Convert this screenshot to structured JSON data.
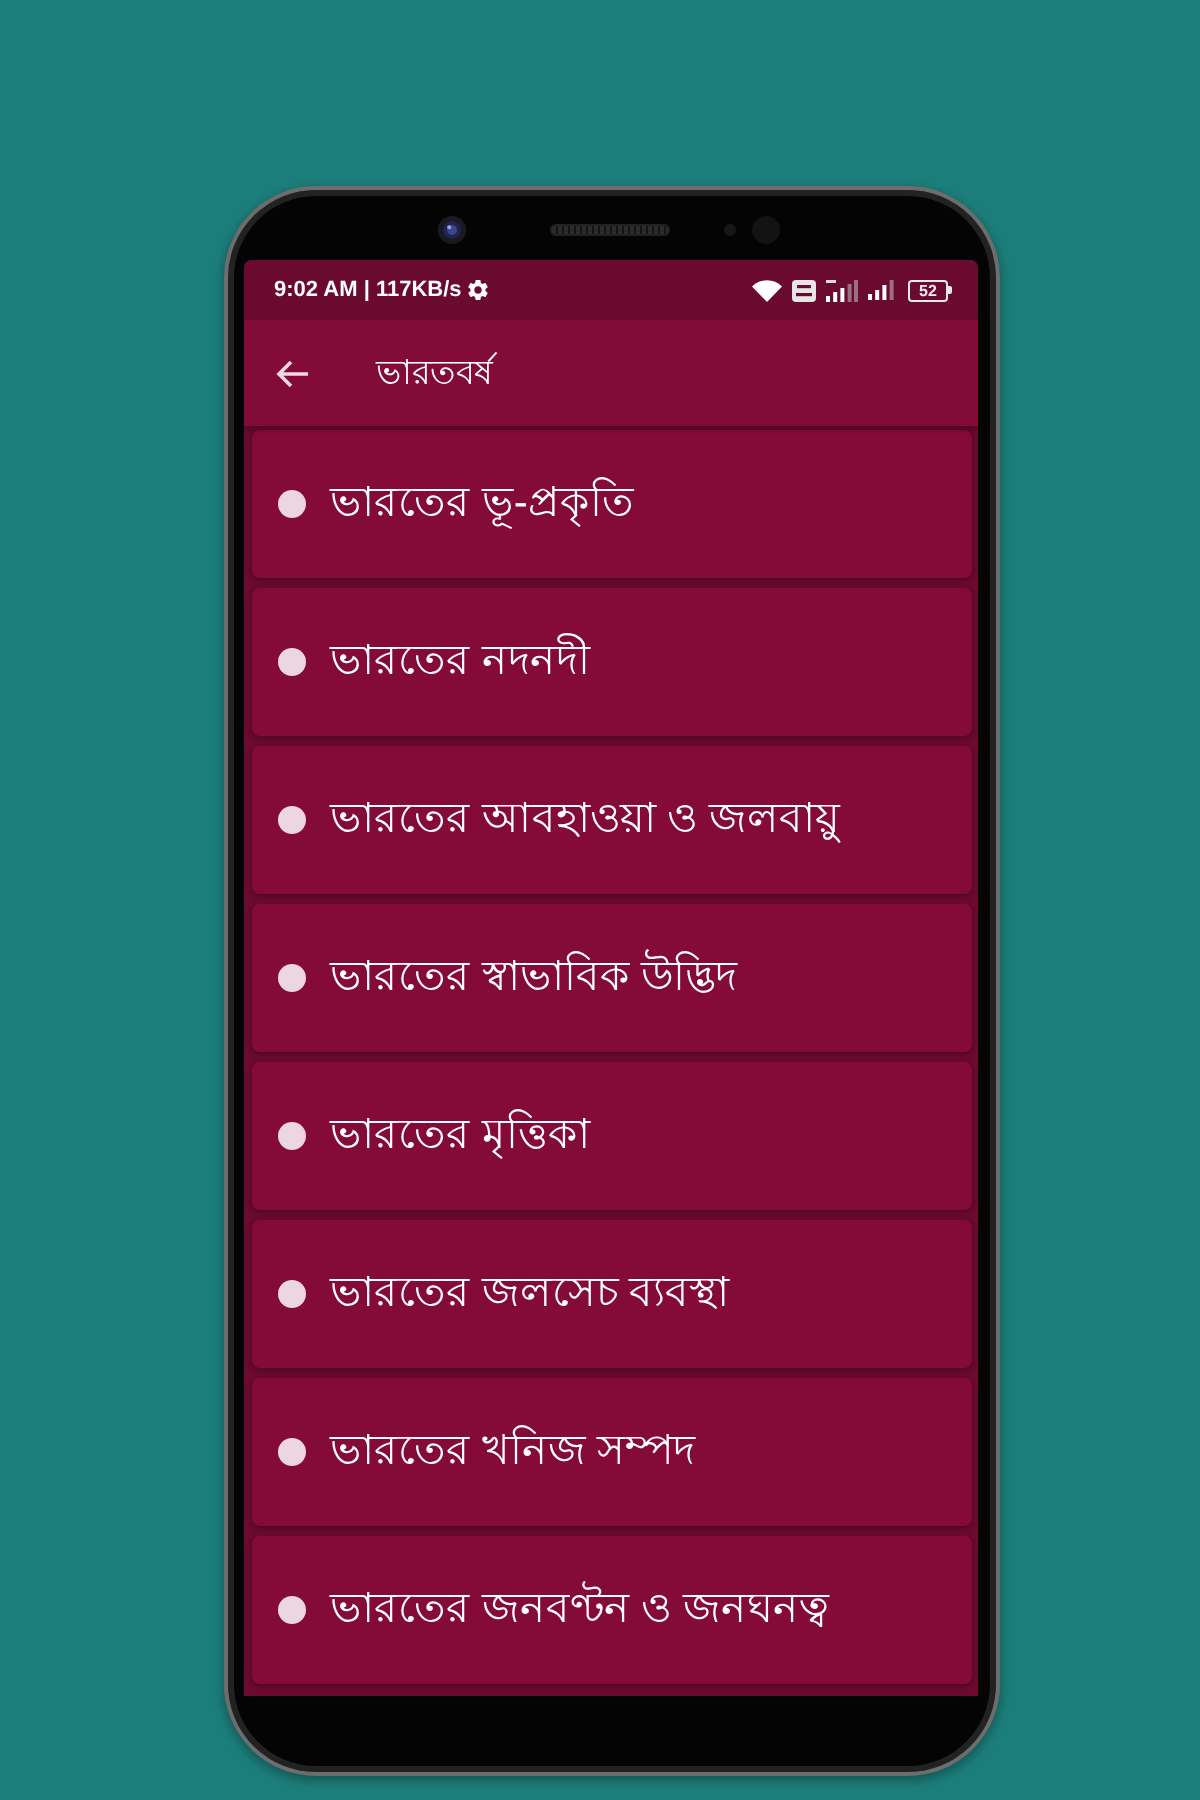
{
  "status_bar": {
    "time": "9:02 AM | 117KB/s",
    "battery": "52"
  },
  "app_bar": {
    "title": "ভারতবর্ষ"
  },
  "list": {
    "items": [
      {
        "label": "ভারতের ভূ-প্রকৃতি"
      },
      {
        "label": "ভারতের নদনদী"
      },
      {
        "label": "ভারতের আবহাওয়া ও জলবায়ু"
      },
      {
        "label": "ভারতের স্বাভাবিক উদ্ভিদ"
      },
      {
        "label": "ভারতের মৃত্তিকা"
      },
      {
        "label": "ভারতের জলসেচ ব্যবস্থা"
      },
      {
        "label": "ভারতের খনিজ সম্পদ"
      },
      {
        "label": "ভারতের জনবণ্টন ও জনঘনত্ব"
      }
    ]
  }
}
